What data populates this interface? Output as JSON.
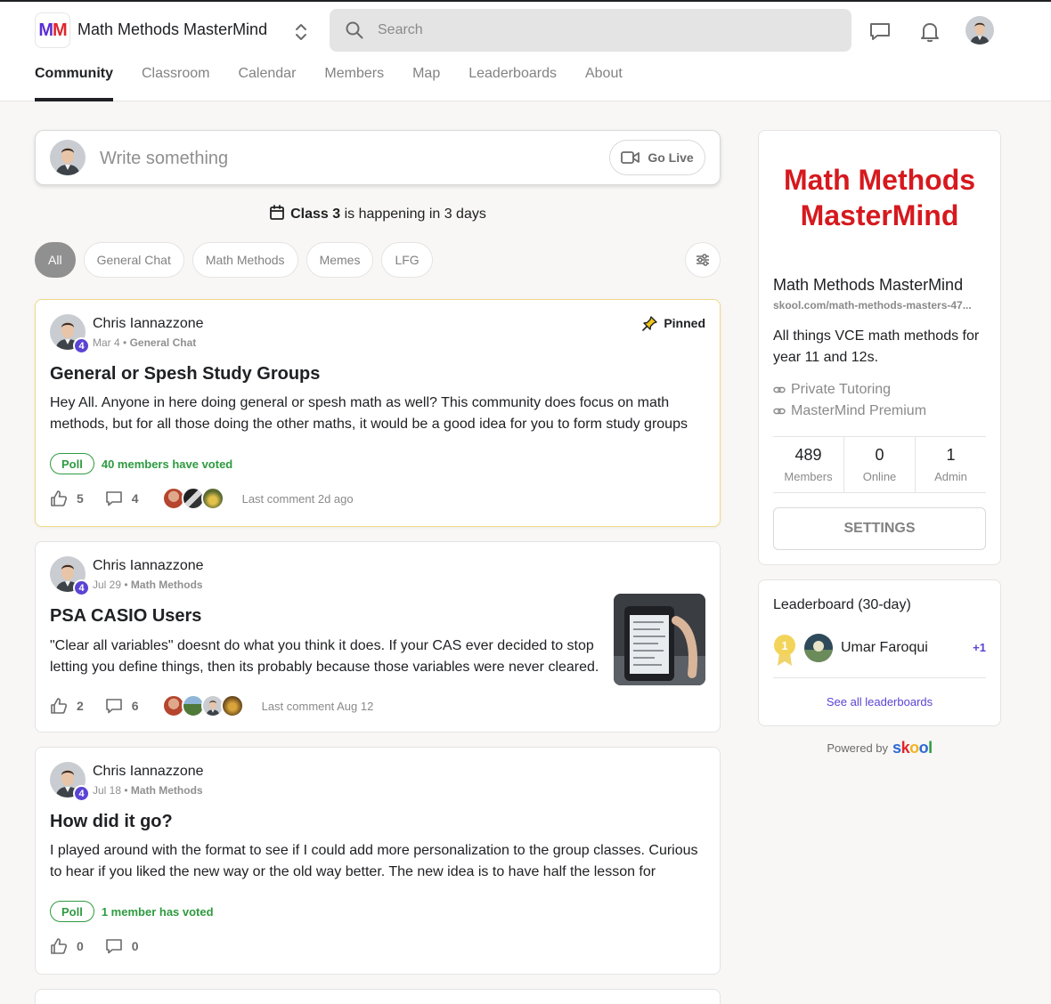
{
  "header": {
    "logo_text": "MM",
    "group_name": "Math Methods MasterMind",
    "search_placeholder": "Search",
    "tabs": [
      {
        "label": "Community",
        "active": true
      },
      {
        "label": "Classroom",
        "active": false
      },
      {
        "label": "Calendar",
        "active": false
      },
      {
        "label": "Members",
        "active": false
      },
      {
        "label": "Map",
        "active": false
      },
      {
        "label": "Leaderboards",
        "active": false
      },
      {
        "label": "About",
        "active": false
      }
    ]
  },
  "composer": {
    "placeholder": "Write something",
    "go_live_label": "Go Live"
  },
  "event_banner": {
    "class_name": "Class 3",
    "text": "is happening in 3 days"
  },
  "filters": {
    "chips": [
      "All",
      "General Chat",
      "Math Methods",
      "Memes",
      "LFG"
    ],
    "active": "All"
  },
  "posts": [
    {
      "author": "Chris Iannazzone",
      "level": "4",
      "date": "Mar 4",
      "category": "General Chat",
      "pinned_label": "Pinned",
      "title": "General or Spesh Study Groups",
      "body": "Hey All. Anyone in here doing general or spesh math as well? This community does focus on math methods, but for all those doing the other maths, it would be a good idea for you to form study groups",
      "poll_label": "Poll",
      "poll_votes": "40 members have voted",
      "likes": "5",
      "comments": "4",
      "last_comment": "Last comment 2d ago"
    },
    {
      "author": "Chris Iannazzone",
      "level": "4",
      "date": "Jul 29",
      "category": "Math Methods",
      "title": "PSA CASIO Users",
      "body": "\"Clear all variables\" doesnt do what you think it does. If your CAS ever decided to stop letting you define things, then its probably because those variables were never cleared.",
      "likes": "2",
      "comments": "6",
      "last_comment": "Last comment Aug 12"
    },
    {
      "author": "Chris Iannazzone",
      "level": "4",
      "date": "Jul 18",
      "category": "Math Methods",
      "title": "How did it go?",
      "body": "I played around with the format to see if I could add more personalization to the group classes. Curious to hear if you liked the new way or the old way better. The new idea is to have half the lesson for",
      "poll_label": "Poll",
      "poll_votes": "1 member has voted",
      "likes": "0",
      "comments": "0"
    }
  ],
  "sidebar": {
    "cover_lines": [
      "Math Methods",
      "MasterMind"
    ],
    "cover_color": "#d6191e",
    "group_name": "Math Methods MasterMind",
    "url": "skool.com/math-methods-masters-47...",
    "description": "All things VCE math methods for year 11 and 12s.",
    "links": [
      "Private Tutoring",
      "MasterMind Premium"
    ],
    "stats": [
      {
        "value": "489",
        "label": "Members"
      },
      {
        "value": "0",
        "label": "Online"
      },
      {
        "value": "1",
        "label": "Admin"
      }
    ],
    "settings_label": "SETTINGS",
    "leaderboard": {
      "title": "Leaderboard (30-day)",
      "entries": [
        {
          "rank": "1",
          "name": "Umar Faroqui",
          "points": "+1"
        }
      ],
      "see_all": "See all leaderboards"
    },
    "powered_by": "Powered by",
    "powered_brand": "skool"
  },
  "colors": {
    "accent": "#5a44d4",
    "poll_green": "#2e9a3f",
    "pinned_border": "#f2d98a"
  }
}
